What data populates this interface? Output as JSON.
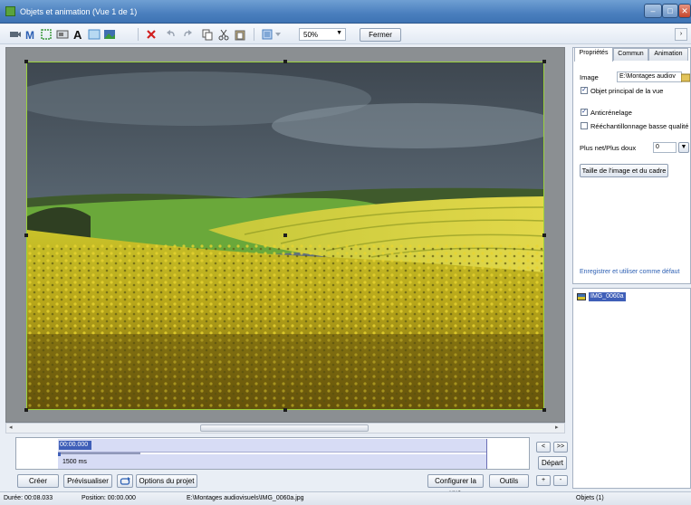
{
  "window": {
    "title": "Objets et animation  (Vue 1 de 1)"
  },
  "toolbar": {
    "zoom": "50%",
    "close_label": "Fermer",
    "more": "›"
  },
  "timeline": {
    "time": "00:00.000",
    "duration": "1500 ms"
  },
  "buttons": {
    "create": "Créer",
    "preview": "Prévisualiser",
    "project_options": "Options du projet",
    "configure_view": "Configurer la vue",
    "tools": "Outils",
    "start": "Départ",
    "prev": "<",
    "next": ">>",
    "add": "+",
    "remove": "-"
  },
  "status": {
    "duration": "Durée: 00:08.033",
    "position": "Position: 00:00.000",
    "file": "E:\\Montages audiovisuels\\IMG_0060a.jpg",
    "objects": "Objets (1)"
  },
  "properties": {
    "tabs": [
      "Propriétés",
      "Commun",
      "Animation"
    ],
    "image_label": "Image",
    "image_path": "E:\\Montages audiov",
    "main_object": "Objet principal de la vue",
    "antialias": "Anticrénelage",
    "lowres": "Rééchantillonnage basse qualité",
    "sharpen_label": "Plus net/Plus doux",
    "sharpen_value": "0",
    "size_button": "Taille de l'image et du cadre",
    "save_default": "Enregistrer et utiliser comme défaut",
    "checks": {
      "main_object": true,
      "antialias": true,
      "lowres": false
    }
  },
  "objects": [
    {
      "name": "IMG_0060a"
    }
  ],
  "colors": {
    "accent": "#3f5fb8",
    "frame": "#9bd23c",
    "titlebar": "#4a7fbe"
  }
}
